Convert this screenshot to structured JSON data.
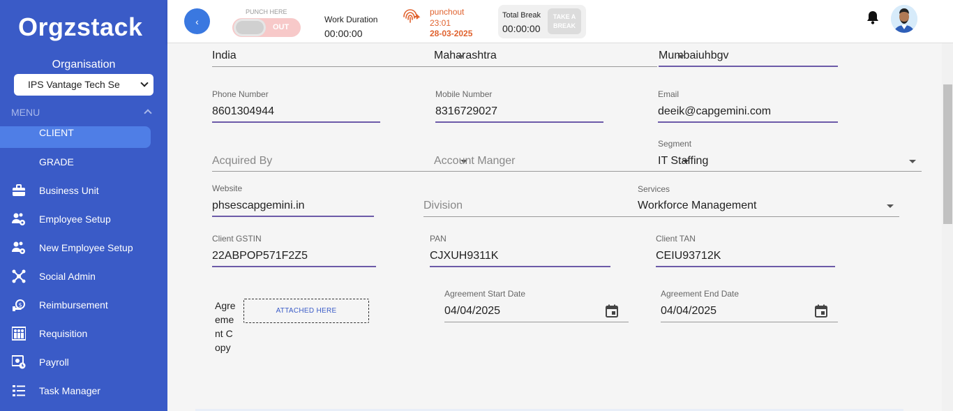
{
  "sidebar": {
    "logo": "Orgzstack",
    "org_label": "Organisation",
    "org_select": "IPS Vantage Tech Se",
    "menu_label": "MENU",
    "items": [
      {
        "label": "CLIENT",
        "icon": "none"
      },
      {
        "label": "GRADE",
        "icon": "none"
      },
      {
        "label": "Business Unit",
        "icon": "briefcase-icon"
      },
      {
        "label": "Employee Setup",
        "icon": "users-gear-icon"
      },
      {
        "label": "New Employee Setup",
        "icon": "users-gear-icon"
      },
      {
        "label": "Social Admin",
        "icon": "network-icon"
      },
      {
        "label": "Reimbursement",
        "icon": "money-hand-icon"
      },
      {
        "label": "Requisition",
        "icon": "people-grid-icon"
      },
      {
        "label": "Payroll",
        "icon": "payroll-clock-icon"
      },
      {
        "label": "Task Manager",
        "icon": "list-icon"
      }
    ]
  },
  "header": {
    "punch_here": "PUNCH HERE",
    "punch_state": "OUT",
    "work_duration_label": "Work Duration",
    "work_duration_value": "00:00:00",
    "punchout_label": "punchout",
    "punchout_time": "23:01",
    "punchout_date": "28-03-2025",
    "total_break_label": "Total Break",
    "total_break_value": "00:00:00",
    "take_break_line1": "TAKE A",
    "take_break_line2": "BREAK"
  },
  "form": {
    "country": "India",
    "state": "Maharashtra",
    "city": "Mumbaiuhbgv",
    "phone_label": "Phone Number",
    "phone_value": "8601304944",
    "mobile_label": "Mobile Number",
    "mobile_value": "8316729027",
    "email_label": "Email",
    "email_value": "deeik@capgemini.com",
    "acquired_by_placeholder": "Acquired By",
    "account_manager_placeholder": "Account Manger",
    "segment_label": "Segment",
    "segment_value": "IT Staffing",
    "website_label": "Website",
    "website_value": "phsescapgemini.in",
    "division_placeholder": "Division",
    "services_label": "Services",
    "services_value": "Workforce Management",
    "gstin_label": "Client GSTIN",
    "gstin_value": "22ABPOP571F2Z5",
    "pan_label": "PAN",
    "pan_value": "CJXUH9311K",
    "tan_label": "Client TAN",
    "tan_value": "CEIU93712K",
    "agreement_copy_label": "Agreement Copy",
    "attach_label": "ATTACHED HERE",
    "start_date_label": "Agreement Start Date",
    "start_date_value": "04/04/2025",
    "end_date_label": "Agreement End Date",
    "end_date_value": "04/04/2025"
  },
  "colors": {
    "sidebar_bg": "#3a5bc7",
    "sidebar_active": "#4f7ee6",
    "accent_underline": "#6c5aa8",
    "punchout_text": "#e0622e"
  }
}
